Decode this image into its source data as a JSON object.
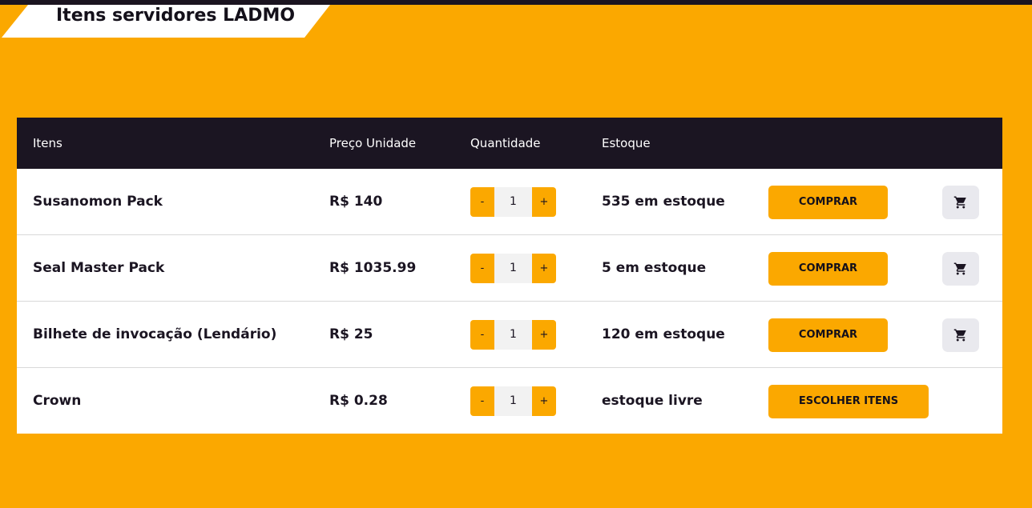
{
  "page": {
    "title": "Itens servidores LADMO"
  },
  "table": {
    "headers": {
      "item": "Itens",
      "price": "Preço Unidade",
      "quantity": "Quantidade",
      "stock": "Estoque"
    },
    "rows": [
      {
        "name": "Susanomon Pack",
        "price": "R$ 140",
        "minus": "-",
        "qty": "1",
        "plus": "+",
        "stock": "535 em estoque",
        "action": "COMPRAR",
        "has_cart": true
      },
      {
        "name": "Seal Master Pack",
        "price": "R$ 1035.99",
        "minus": "-",
        "qty": "1",
        "plus": "+",
        "stock": "5 em estoque",
        "action": "COMPRAR",
        "has_cart": true
      },
      {
        "name": "Bilhete de invocação (Lendário)",
        "price": "R$ 25",
        "minus": "-",
        "qty": "1",
        "plus": "+",
        "stock": "120 em estoque",
        "action": "COMPRAR",
        "has_cart": true
      },
      {
        "name": "Crown",
        "price": "R$ 0.28",
        "minus": "-",
        "qty": "1",
        "plus": "+",
        "stock": "estoque livre",
        "action": "ESCOLHER ITENS",
        "has_cart": false
      }
    ]
  },
  "icons": {
    "cart": "shopping-cart-icon"
  },
  "colors": {
    "background": "#FBA800",
    "header": "#1b1522",
    "button": "#FBA800",
    "cart_button": "#e9e9ee"
  }
}
